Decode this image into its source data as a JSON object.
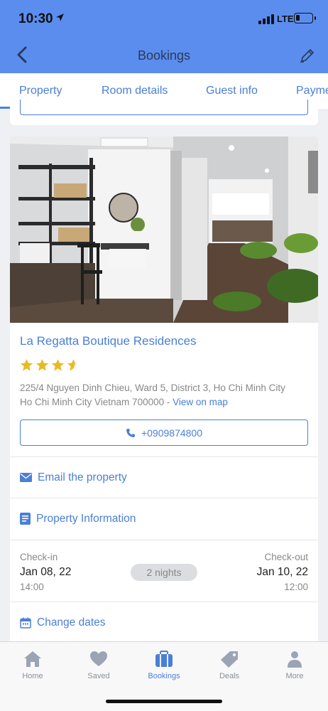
{
  "status_bar": {
    "time": "10:30",
    "network": "LTE"
  },
  "nav": {
    "title": "Bookings"
  },
  "tabs": [
    {
      "label": "Property",
      "active": true
    },
    {
      "label": "Room details"
    },
    {
      "label": "Guest info"
    },
    {
      "label": "Payme"
    }
  ],
  "property": {
    "name": "La Regatta Boutique Residences",
    "stars": 3.5,
    "address_line1": "225/4 Nguyen Dinh Chieu, Ward 5, District 3, Ho Chi Minh City",
    "address_line2": "Ho Chi Minh City Vietnam 700000 - ",
    "map_link": "View on map",
    "phone": "+0909874800",
    "email_label": "Email the property",
    "info_label": "Property Information"
  },
  "stay": {
    "checkin_label": "Check-in",
    "checkin_date": "Jan 08, 22",
    "checkin_time": "14:00",
    "nights": "2 nights",
    "checkout_label": "Check-out",
    "checkout_date": "Jan 10, 22",
    "checkout_time": "12:00",
    "change_dates_label": "Change dates"
  },
  "tabbar": {
    "items": [
      {
        "label": "Home",
        "icon": "home-icon"
      },
      {
        "label": "Saved",
        "icon": "heart-icon"
      },
      {
        "label": "Bookings",
        "icon": "suitcase-icon",
        "active": true
      },
      {
        "label": "Deals",
        "icon": "tag-icon"
      },
      {
        "label": "More",
        "icon": "person-icon"
      }
    ]
  },
  "colors": {
    "header": "#5b8def",
    "accent": "#4a7fd6",
    "star": "#e8b923"
  }
}
